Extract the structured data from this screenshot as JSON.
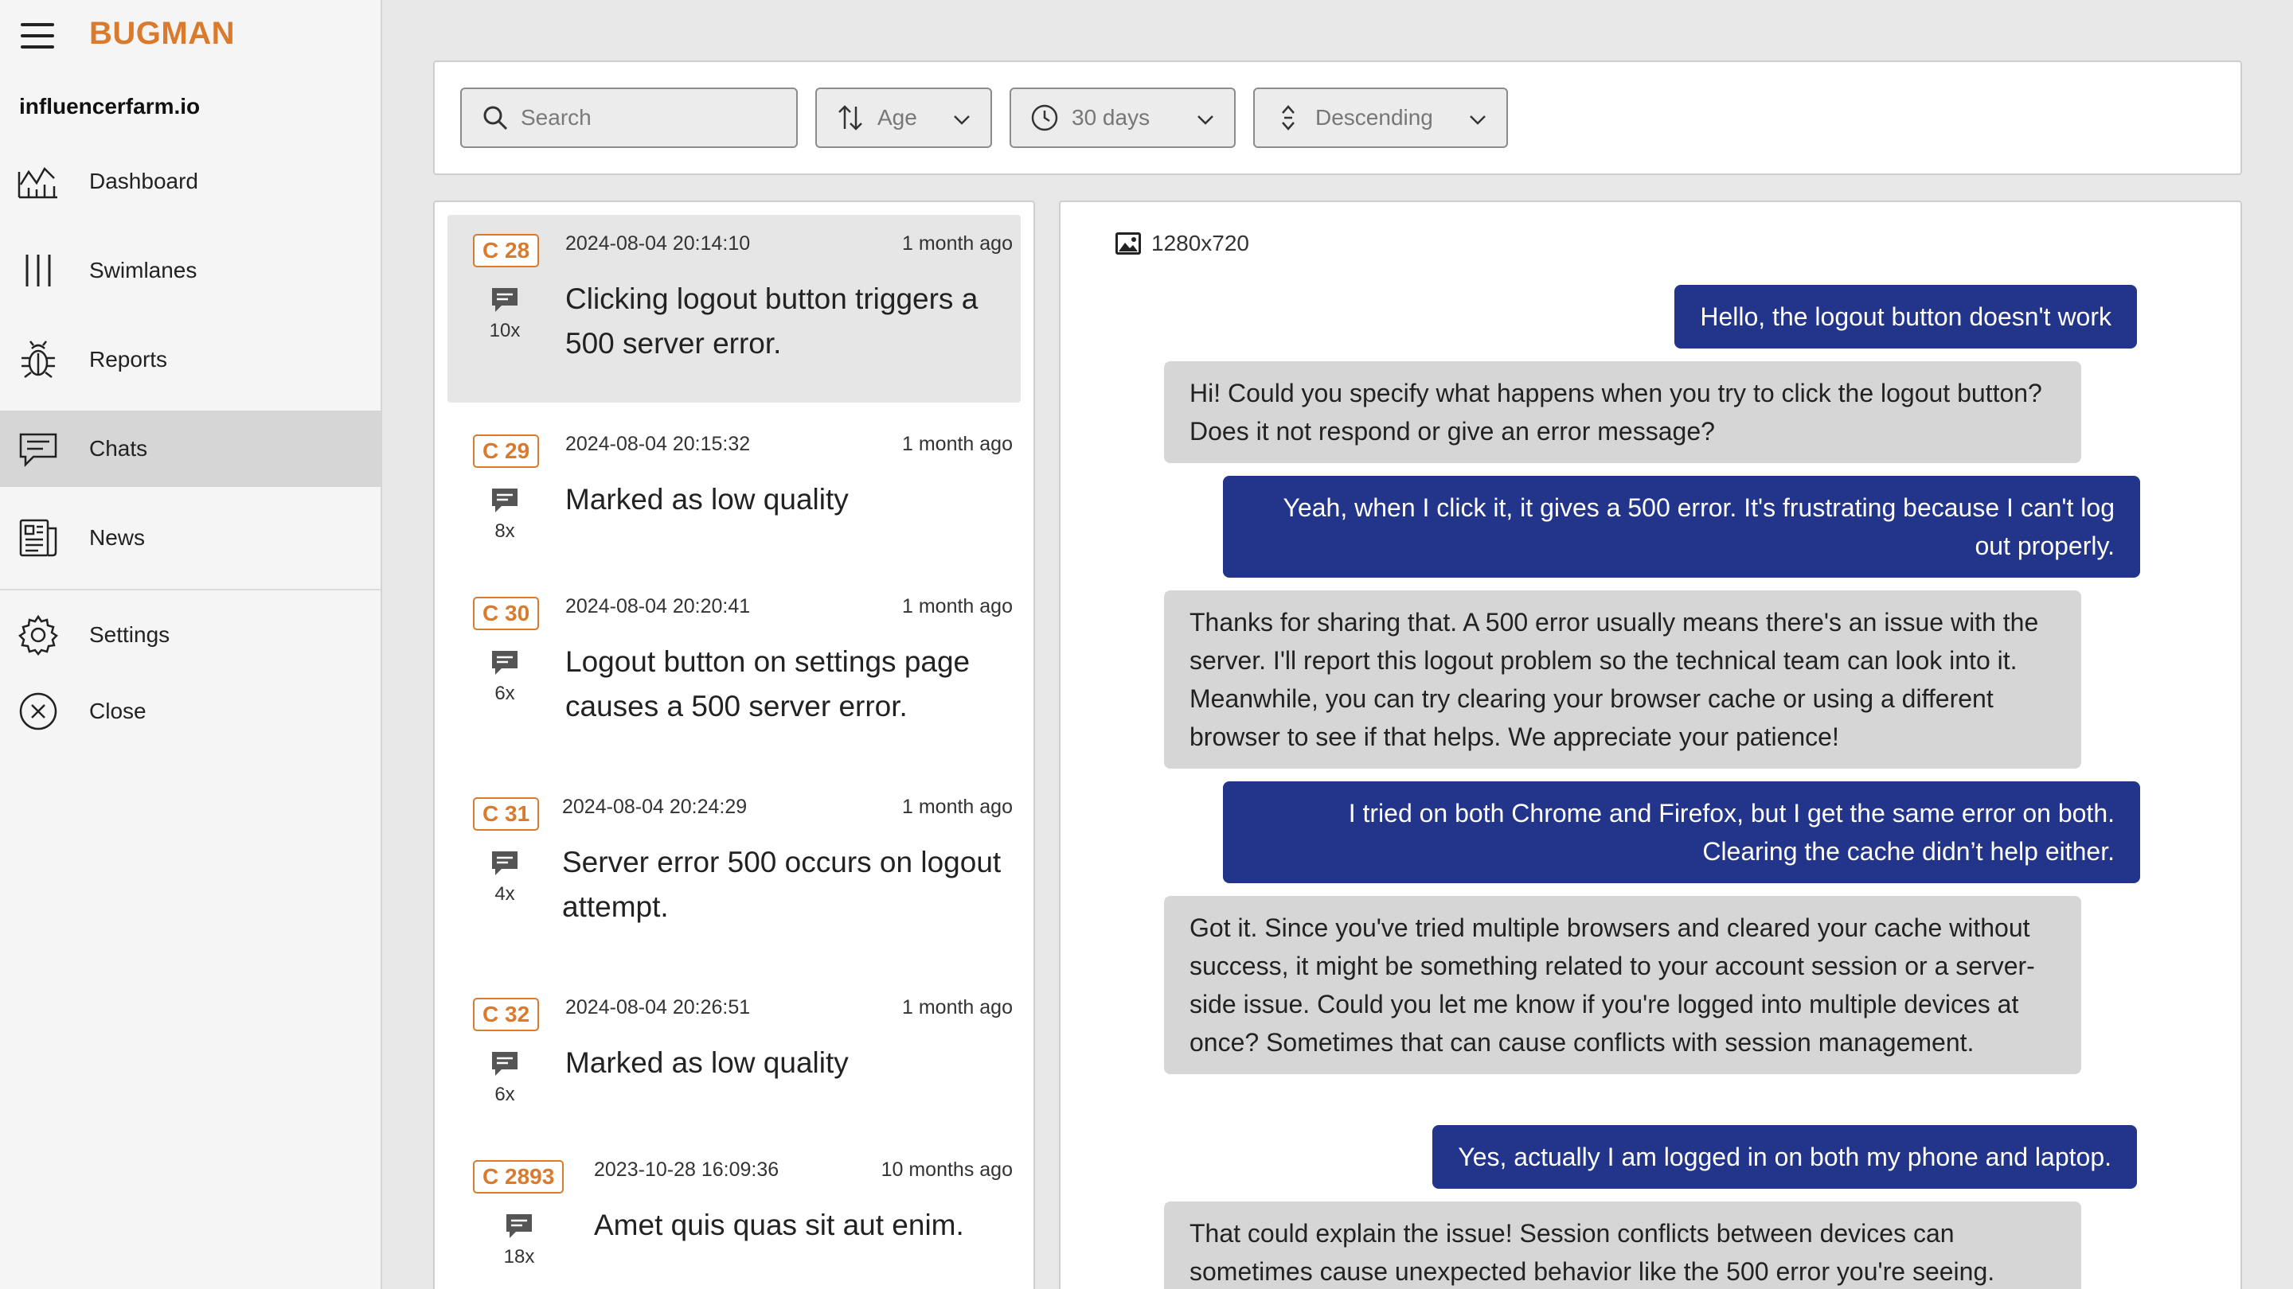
{
  "app": {
    "brand": "BUGMAN",
    "org": "influencerfarm.io"
  },
  "nav": [
    {
      "label": "Dashboard",
      "icon": "chart-line-icon"
    },
    {
      "label": "Swimlanes",
      "icon": "swimlanes-icon"
    },
    {
      "label": "Reports",
      "icon": "bug-icon"
    },
    {
      "label": "Chats",
      "icon": "chat-icon",
      "active": true
    },
    {
      "label": "News",
      "icon": "newspaper-icon"
    },
    {
      "label": "Settings",
      "icon": "gear-icon"
    },
    {
      "label": "Close",
      "icon": "close-circle-icon"
    }
  ],
  "filters": {
    "search_placeholder": "Search",
    "sort_by": "Age",
    "range": "30 days",
    "order": "Descending"
  },
  "chats": [
    {
      "id": "C 28",
      "count": "10x",
      "date": "2024-08-04 20:14:10",
      "ago": "1 month ago",
      "summary": "Clicking logout button triggers a 500 server error."
    },
    {
      "id": "C 29",
      "count": "8x",
      "date": "2024-08-04 20:15:32",
      "ago": "1 month ago",
      "summary": "Marked as low quality"
    },
    {
      "id": "C 30",
      "count": "6x",
      "date": "2024-08-04 20:20:41",
      "ago": "1 month ago",
      "summary": "Logout button on settings page causes a 500 server error."
    },
    {
      "id": "C 31",
      "count": "4x",
      "date": "2024-08-04 20:24:29",
      "ago": "1 month ago",
      "summary": "Server error 500 occurs on logout attempt."
    },
    {
      "id": "C 32",
      "count": "6x",
      "date": "2024-08-04 20:26:51",
      "ago": "1 month ago",
      "summary": "Marked as low quality"
    },
    {
      "id": "C 2893",
      "count": "18x",
      "date": "2023-10-28 16:09:36",
      "ago": "10 months ago",
      "summary": "Amet quis quas sit aut enim."
    }
  ],
  "conversation": {
    "resolution": "1280x720",
    "messages": [
      {
        "role": "user",
        "text": "Hello, the logout button doesn't work"
      },
      {
        "role": "bot",
        "text": "Hi! Could you specify what happens when you try to click the logout button? Does it not respond or give an error message?"
      },
      {
        "role": "user",
        "text": "Yeah, when I click it, it gives a 500 error. It's frustrating because I can't log out properly."
      },
      {
        "role": "bot",
        "text": "Thanks for sharing that. A 500 error usually means there's an issue with the server. I'll report this logout problem so the technical team can look into it. Meanwhile, you can try clearing your browser cache or using a different browser to see if that helps. We appreciate your patience!"
      },
      {
        "role": "user",
        "text": "I tried on both Chrome and Firefox, but I get the same error on both. Clearing the cache didn’t help either."
      },
      {
        "role": "bot",
        "text": "Got it. Since you've tried multiple browsers and cleared your cache without success, it might be something related to your account session or a server-side issue. Could you let me know if you're logged into multiple devices at once? Sometimes that can cause conflicts with session management."
      },
      {
        "role": "user",
        "text": "Yes, actually I am logged in on both my phone and laptop."
      },
      {
        "role": "bot",
        "text": "That could explain the issue! Session conflicts between devices can sometimes cause unexpected behavior like the 500 error you're seeing."
      }
    ]
  }
}
